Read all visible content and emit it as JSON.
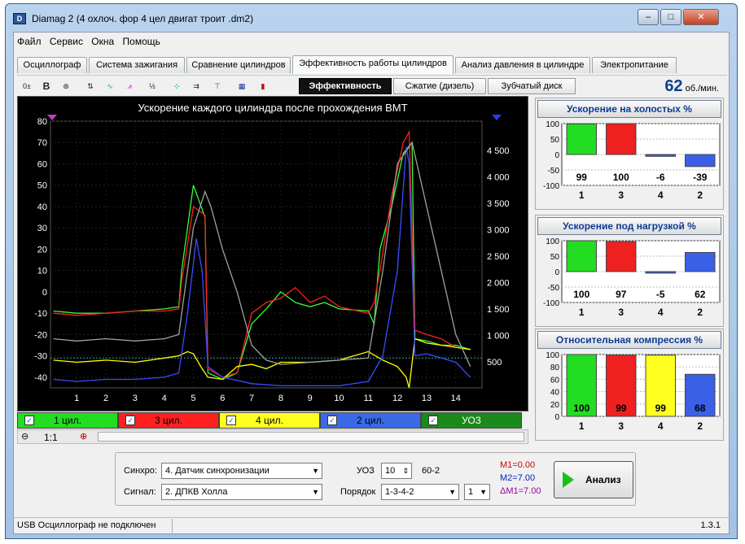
{
  "window": {
    "title": "Diamag 2 (4 охлоч. фор 4 цел   двигат троит .dm2)",
    "icon": "app-logo-icon"
  },
  "menu": [
    "Файл",
    "Сервис",
    "Окна",
    "Помощь"
  ],
  "tabs": [
    "Осциллограф",
    "Система зажигания",
    "Сравнение цилиндров",
    "Эффективность работы цилиндров",
    "Анализ давления в цилиндре",
    "Электропитание"
  ],
  "subtabs": [
    "Эффективность",
    "Сжатие (дизель)",
    "Зубчатый диск"
  ],
  "rpm": {
    "value": "62",
    "unit": "об./мин."
  },
  "chart_data": {
    "type": "line",
    "title": "Ускорение каждого цилиндра после прохождения ВМТ",
    "x_ticks": [
      "1",
      "2",
      "3",
      "4",
      "5",
      "6",
      "7",
      "8",
      "9",
      "10",
      "11",
      "12",
      "13",
      "14"
    ],
    "y_left_ticks": [
      "80",
      "70",
      "60",
      "50",
      "40",
      "30",
      "20",
      "10",
      "0",
      "-10",
      "-20",
      "-30",
      "-40"
    ],
    "y_right_ticks": [
      "4 500",
      "4 000",
      "3 500",
      "3 000",
      "2 500",
      "2 000",
      "1 500",
      "1 000",
      "500"
    ],
    "xlim": [
      0.1,
      14.9
    ],
    "ylim": [
      -45,
      80
    ],
    "series": [
      {
        "name": "1 цил.",
        "color": "#33ff33",
        "points": [
          [
            0.2,
            -9
          ],
          [
            1,
            -10
          ],
          [
            2,
            -10
          ],
          [
            3,
            -9
          ],
          [
            4,
            -8
          ],
          [
            4.5,
            -7
          ],
          [
            4.6,
            10
          ],
          [
            5,
            50
          ],
          [
            5.4,
            35
          ],
          [
            5.5,
            -38
          ],
          [
            6,
            -41
          ],
          [
            6.5,
            -38
          ],
          [
            7,
            -15
          ],
          [
            7.5,
            -8
          ],
          [
            8,
            0
          ],
          [
            8.5,
            -5
          ],
          [
            9,
            -7
          ],
          [
            9.5,
            -5
          ],
          [
            10,
            -8
          ],
          [
            11,
            -9
          ],
          [
            11.2,
            -15
          ],
          [
            11.4,
            20
          ],
          [
            11.8,
            40
          ],
          [
            12.2,
            65
          ],
          [
            12.5,
            70
          ],
          [
            12.6,
            -22
          ],
          [
            13,
            -23
          ],
          [
            13.5,
            -25
          ],
          [
            14,
            -25
          ],
          [
            14.5,
            -27
          ]
        ]
      },
      {
        "name": "3 цил.",
        "color": "#ff2020",
        "points": [
          [
            0.2,
            -10
          ],
          [
            1,
            -11
          ],
          [
            2,
            -10
          ],
          [
            3,
            -9
          ],
          [
            4,
            -9
          ],
          [
            4.5,
            -8
          ],
          [
            4.6,
            5
          ],
          [
            5,
            40
          ],
          [
            5.4,
            36
          ],
          [
            5.5,
            -36
          ],
          [
            6,
            -40
          ],
          [
            6.5,
            -38
          ],
          [
            7,
            -10
          ],
          [
            7.5,
            -5
          ],
          [
            8,
            -3
          ],
          [
            8.5,
            2
          ],
          [
            9,
            -5
          ],
          [
            9.5,
            -2
          ],
          [
            10,
            -7
          ],
          [
            11,
            -10
          ],
          [
            11.2,
            -5
          ],
          [
            11.4,
            10
          ],
          [
            11.8,
            45
          ],
          [
            12.2,
            70
          ],
          [
            12.4,
            75
          ],
          [
            12.6,
            -18
          ],
          [
            13,
            -20
          ],
          [
            13.5,
            -22
          ],
          [
            14,
            -26
          ]
        ]
      },
      {
        "name": "4 цил.",
        "color": "#ffff00",
        "points": [
          [
            0.2,
            -32
          ],
          [
            1,
            -33
          ],
          [
            2,
            -32
          ],
          [
            3,
            -33
          ],
          [
            4,
            -31
          ],
          [
            4.5,
            -30
          ],
          [
            4.8,
            -28
          ],
          [
            5,
            -29
          ],
          [
            5.3,
            -36
          ],
          [
            5.5,
            -40
          ],
          [
            6,
            -41
          ],
          [
            6.5,
            -35
          ],
          [
            7,
            -34
          ],
          [
            7.5,
            -36
          ],
          [
            8,
            -33
          ],
          [
            9,
            -33
          ],
          [
            10,
            -32
          ],
          [
            11,
            -28
          ],
          [
            11.5,
            -32
          ],
          [
            12,
            -35
          ],
          [
            12.3,
            -40
          ],
          [
            12.4,
            -45
          ],
          [
            12.6,
            -22
          ],
          [
            13,
            -24
          ],
          [
            13.5,
            -25
          ],
          [
            14,
            -26
          ],
          [
            14.5,
            -27
          ]
        ]
      },
      {
        "name": "2 цил.",
        "color": "#3a4dff",
        "points": [
          [
            0.2,
            -41
          ],
          [
            1,
            -42
          ],
          [
            2,
            -41
          ],
          [
            3,
            -41
          ],
          [
            4,
            -40
          ],
          [
            4.5,
            -38
          ],
          [
            4.8,
            -10
          ],
          [
            5.1,
            25
          ],
          [
            5.3,
            10
          ],
          [
            5.5,
            -35
          ],
          [
            6,
            -40
          ],
          [
            7,
            -43
          ],
          [
            8,
            -44
          ],
          [
            9,
            -44
          ],
          [
            10,
            -44
          ],
          [
            11,
            -42
          ],
          [
            11.5,
            -30
          ],
          [
            12,
            10
          ],
          [
            12.3,
            68
          ],
          [
            12.4,
            60
          ],
          [
            12.6,
            -30
          ],
          [
            13,
            -29
          ],
          [
            14,
            -33
          ],
          [
            14.5,
            -40
          ]
        ]
      },
      {
        "name": "УОЗ",
        "color": "#a0a0a0",
        "points": [
          [
            0.2,
            -22
          ],
          [
            1,
            -23
          ],
          [
            2,
            -22
          ],
          [
            3,
            -23
          ],
          [
            4,
            -22
          ],
          [
            4.5,
            -20
          ],
          [
            5,
            30
          ],
          [
            5.4,
            47
          ],
          [
            5.6,
            40
          ],
          [
            6,
            20
          ],
          [
            6.5,
            0
          ],
          [
            7,
            -25
          ],
          [
            7.5,
            -32
          ],
          [
            8,
            -34
          ],
          [
            9,
            -33
          ],
          [
            10,
            -32
          ],
          [
            11,
            -31
          ],
          [
            11.5,
            10
          ],
          [
            12,
            60
          ],
          [
            12.5,
            70
          ],
          [
            13,
            40
          ],
          [
            13.5,
            10
          ],
          [
            14,
            -20
          ],
          [
            14.5,
            -35
          ]
        ]
      }
    ]
  },
  "legend": [
    {
      "label": "1 цил.",
      "color": "#22dd22"
    },
    {
      "label": "3 цил.",
      "color": "#ff2020"
    },
    {
      "label": "4 цил.",
      "color": "#ffff20"
    },
    {
      "label": "2 цил.",
      "color": "#3a6ae8"
    },
    {
      "label": "УОЗ",
      "color": "#1a8a1a"
    }
  ],
  "zoom": {
    "value": "1:1"
  },
  "panels": [
    {
      "title": "Ускорение на холостых %",
      "labels": [
        "1",
        "3",
        "4",
        "2"
      ],
      "values": [
        99,
        100,
        -6,
        -39
      ],
      "value_labels": [
        "99",
        "100",
        "-6",
        "-39"
      ],
      "colors": [
        "#22dd22",
        "#ee2020",
        "#3a60e8",
        "#3a60e8"
      ],
      "ylim": [
        -100,
        100
      ],
      "ticks": [
        "100",
        "50",
        "0",
        "-50",
        "-100"
      ]
    },
    {
      "title": "Ускорение под нагрузкой %",
      "labels": [
        "1",
        "3",
        "4",
        "2"
      ],
      "values": [
        100,
        97,
        -5,
        62
      ],
      "value_labels": [
        "100",
        "97",
        "-5",
        "62"
      ],
      "colors": [
        "#22dd22",
        "#ee2020",
        "#3a60e8",
        "#3a60e8"
      ],
      "ylim": [
        -100,
        100
      ],
      "ticks": [
        "100",
        "50",
        "0",
        "-50",
        "-100"
      ]
    },
    {
      "title": "Относительная компрессия %",
      "labels": [
        "1",
        "3",
        "4",
        "2"
      ],
      "values": [
        100,
        99,
        99,
        68
      ],
      "value_labels": [
        "100",
        "99",
        "99",
        "68"
      ],
      "colors": [
        "#22dd22",
        "#ee2020",
        "#ffff20",
        "#3a60e8"
      ],
      "ylim": [
        0,
        100
      ],
      "ticks": [
        "100",
        "80",
        "60",
        "40",
        "20",
        "0"
      ]
    }
  ],
  "sync": {
    "label": "Синхро:",
    "value": "4.  Датчик синхронизации"
  },
  "signal": {
    "label": "Сигнал:",
    "value": "2.  ДПКВ Холла"
  },
  "uoz": {
    "label": "УОЗ",
    "value": "10",
    "teeth": "60-2"
  },
  "order": {
    "label": "Порядок",
    "value": "1-3-4-2",
    "second": "1"
  },
  "markers": {
    "m1": "M1=0.00",
    "m2": "M2=7.00",
    "dm1": "ΔM1=7.00"
  },
  "analyze_label": "Анализ",
  "status": {
    "left": "USB Осциллограф не подключен",
    "version": "1.3.1"
  }
}
